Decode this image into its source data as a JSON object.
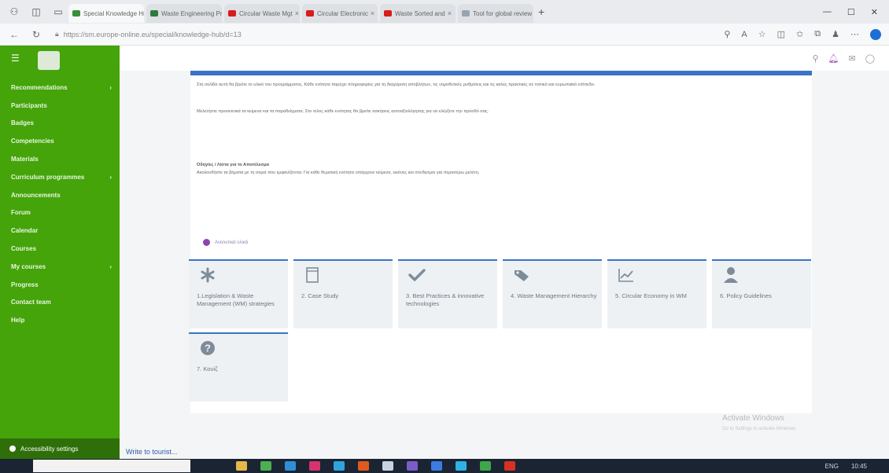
{
  "browser": {
    "tabs": [
      {
        "label": "Special Knowledge Hub",
        "color": "#3a8f3a",
        "active": true
      },
      {
        "label": "Waste Engineering Pr",
        "color": "#2f7a3f",
        "active": false
      },
      {
        "label": "Circular Waste Mgt",
        "color": "#d81b1b",
        "active": false
      },
      {
        "label": "Circular Electronic",
        "color": "#d81b1b",
        "active": false
      },
      {
        "label": "Waste Sorted and",
        "color": "#d81b1b",
        "active": false
      },
      {
        "label": "Tool for global review",
        "color": "#9aa4b0",
        "active": false
      }
    ],
    "new_tab": "+",
    "url": "https://sm.europe-online.eu/special/knowledge-hub/d=13"
  },
  "sidebar": {
    "items": [
      {
        "label": "Recommendations",
        "chev": "›"
      },
      {
        "label": "Participants",
        "chev": ""
      },
      {
        "label": "Badges",
        "chev": ""
      },
      {
        "label": "Competencies",
        "chev": ""
      },
      {
        "label": "Materials",
        "chev": ""
      },
      {
        "label": "Curriculum programmes",
        "chev": "›"
      },
      {
        "label": "Announcements",
        "chev": ""
      },
      {
        "label": "Forum",
        "chev": ""
      },
      {
        "label": "Calendar",
        "chev": ""
      },
      {
        "label": "Courses",
        "chev": ""
      },
      {
        "label": "My courses",
        "chev": "›"
      },
      {
        "label": "Progress",
        "chev": ""
      },
      {
        "label": "Contact team",
        "chev": ""
      },
      {
        "label": "Help",
        "chev": ""
      }
    ],
    "bottom": "Accessibility settings"
  },
  "content": {
    "paragraphs": [
      "Στη σελίδα αυτή θα βρείτε το υλικό του προγράμματος. Κάθε ενότητα παρέχει πληροφορίες για τη διαχείριση αποβλήτων, τις νομοθετικές ρυθμίσεις και τις καλές πρακτικές σε τοπικό και ευρωπαϊκό επίπεδο.",
      "Μελετήστε προσεκτικά τα κείμενα και τα παραδείγματα. Στο τέλος κάθε ενότητας θα βρείτε ασκήσεις αυτοαξιολόγησης για να ελέγξετε την πρόοδό σας.",
      "Οδηγίες / Λίστα για το Αποτέλεσμα",
      "Ακολουθήστε τα βήματα με τη σειρά που εμφανίζονται. Για κάθε θεματική ενότητα υπάρχουν κείμενα, εικόνες και σύνδεσμοι για περαιτέρω μελέτη."
    ],
    "attachment": "Αναλυτικά υλικά"
  },
  "tiles": [
    {
      "icon": "asterisk-icon",
      "label": "1.Legislation & Waste Management (WM) strategies"
    },
    {
      "icon": "book-icon",
      "label": "2. Case Study"
    },
    {
      "icon": "check-icon",
      "label": "3. Best Practices & innovative technologies"
    },
    {
      "icon": "tag-icon",
      "label": "4. Waste Management Hierarchy"
    },
    {
      "icon": "chart-icon",
      "label": "5. Circular Economy in WM"
    },
    {
      "icon": "person-icon",
      "label": "6. Policy Guidelines"
    },
    {
      "icon": "question-icon",
      "label": "7. Κουίζ"
    }
  ],
  "footer": {
    "link": "Write to tourist..."
  },
  "watermark": {
    "title": "Activate Windows",
    "sub": "Go to Settings to activate Windows."
  },
  "taskbar": {
    "time": "10:45",
    "tray": "ENG"
  }
}
